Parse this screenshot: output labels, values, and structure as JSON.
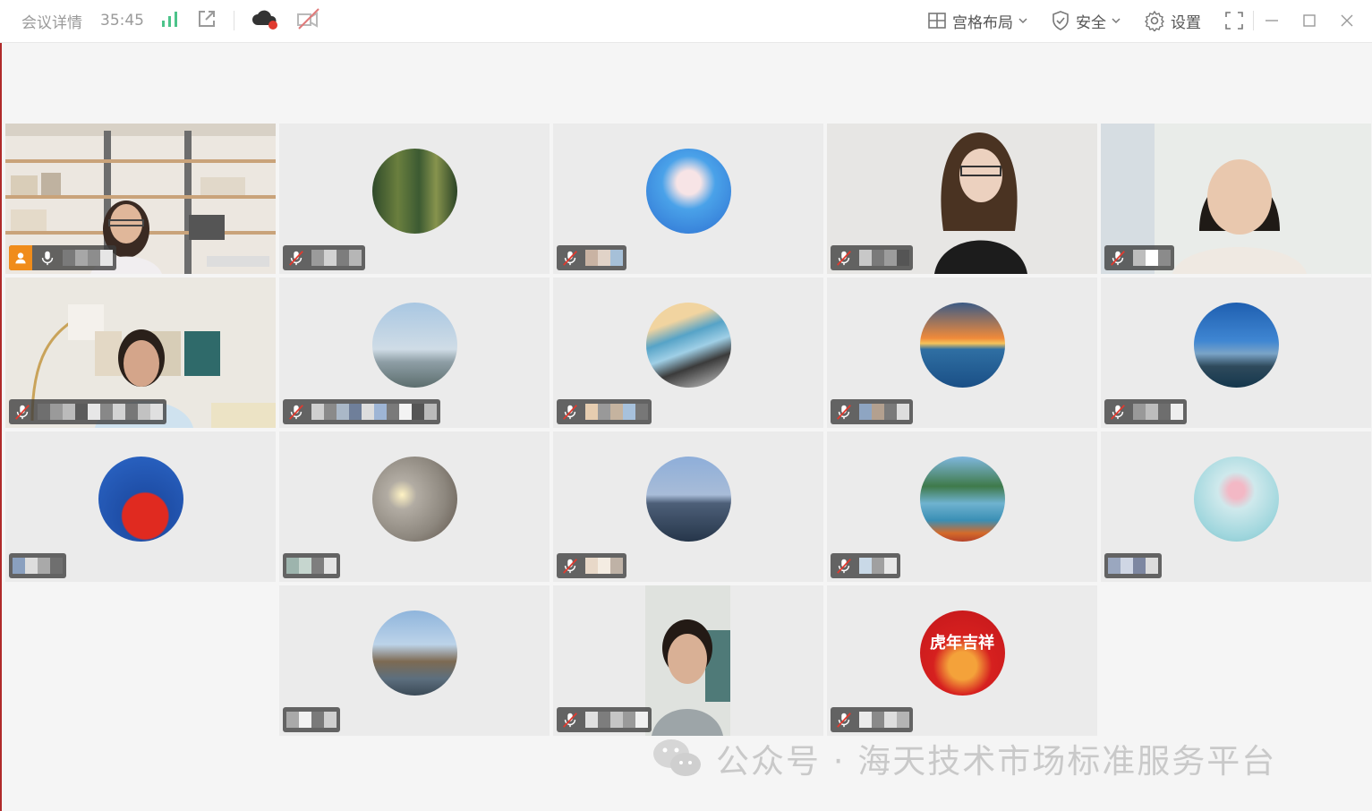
{
  "topbar": {
    "meeting_details": "会议详情",
    "timer": "35:45",
    "layout_label": "宫格布局",
    "security_label": "安全",
    "settings_label": "设置"
  },
  "watermark": {
    "text": "公众号 · 海天技术市场标准服务平台"
  },
  "colors": {
    "accent_red": "#e03a2f",
    "host_orange": "#f08c1b",
    "signal_green": "#4cc38a"
  },
  "participants": [
    {
      "kind": "video",
      "muted": false,
      "host": true
    },
    {
      "kind": "avatar",
      "avatar": "forest",
      "muted": true
    },
    {
      "kind": "avatar",
      "avatar": "anime-girl",
      "muted": true
    },
    {
      "kind": "video",
      "muted": true
    },
    {
      "kind": "video",
      "muted": true
    },
    {
      "kind": "video",
      "muted": true
    },
    {
      "kind": "avatar",
      "avatar": "coast",
      "muted": true
    },
    {
      "kind": "avatar",
      "avatar": "car",
      "muted": true
    },
    {
      "kind": "avatar",
      "avatar": "sunset-sea",
      "muted": true
    },
    {
      "kind": "avatar",
      "avatar": "city-skyline",
      "muted": true
    },
    {
      "kind": "avatar",
      "avatar": "china-flag",
      "muted": false
    },
    {
      "kind": "avatar",
      "avatar": "lamp-room",
      "muted": false
    },
    {
      "kind": "avatar",
      "avatar": "calm-sea",
      "muted": true
    },
    {
      "kind": "avatar",
      "avatar": "lake",
      "muted": true
    },
    {
      "kind": "avatar",
      "avatar": "flower-vase",
      "muted": false
    },
    {
      "kind": "avatar",
      "avatar": "big-ben",
      "muted": false
    },
    {
      "kind": "video",
      "muted": true
    },
    {
      "kind": "avatar",
      "avatar": "tiger-new-year",
      "muted": true
    }
  ]
}
